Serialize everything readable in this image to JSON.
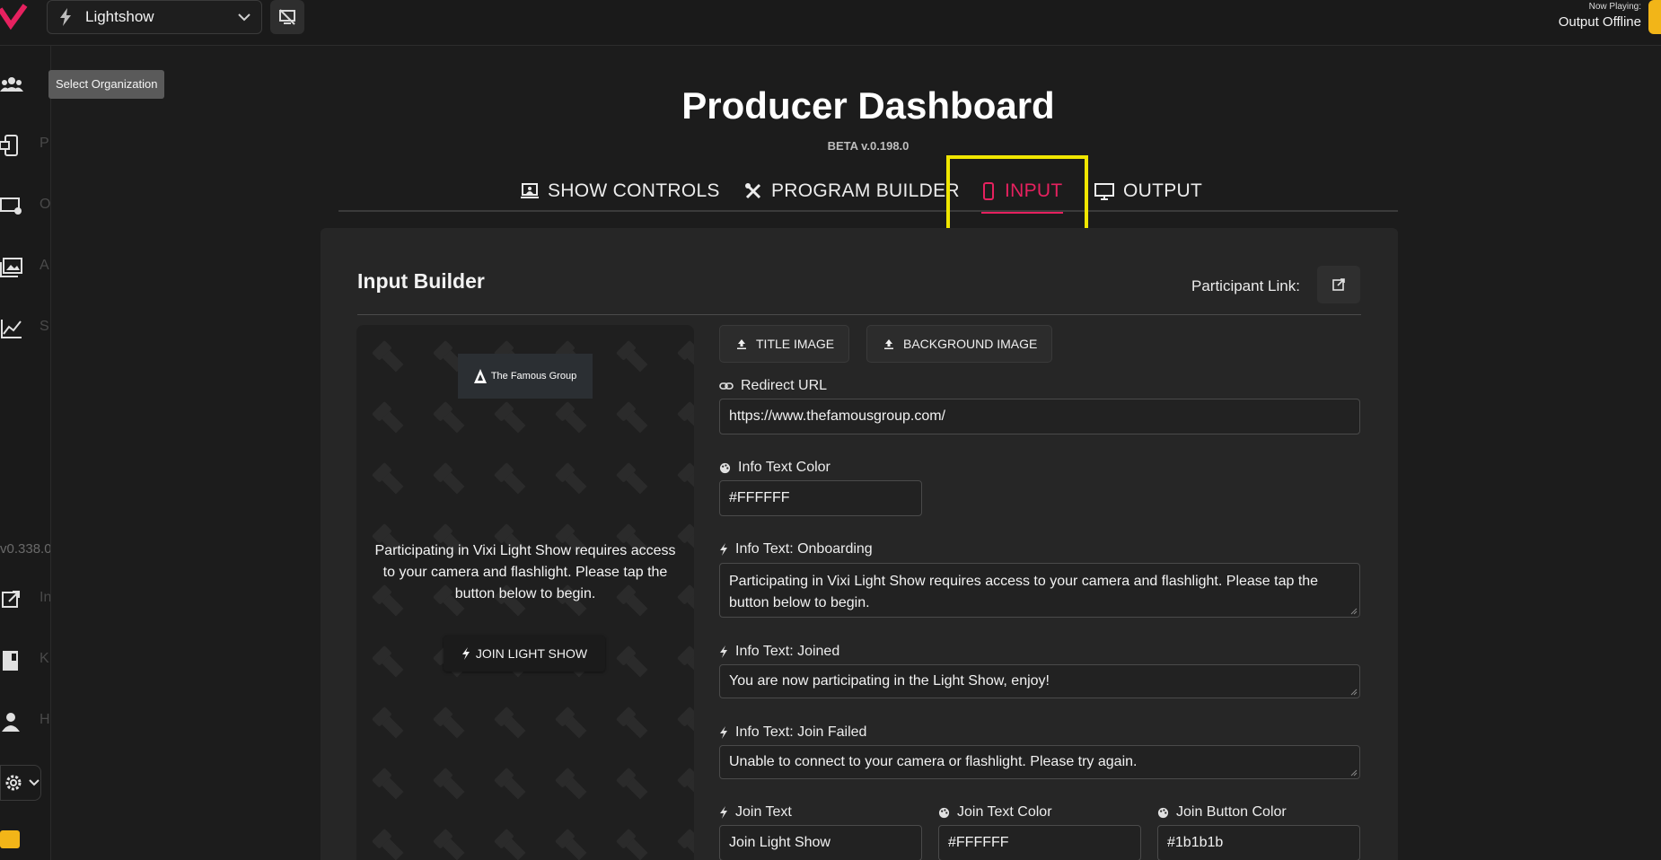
{
  "topbar": {
    "show_name": "Lightshow",
    "now_playing_label": "Now Playing:",
    "now_playing_status": "Output Offline"
  },
  "tooltip": "Select Organization",
  "sidebar": {
    "items": [
      {
        "icon": "organization-icon",
        "label": "O"
      },
      {
        "icon": "device-icon",
        "label": "P"
      },
      {
        "icon": "display-settings-icon",
        "label": "O"
      },
      {
        "icon": "media-library-icon",
        "label": "A"
      },
      {
        "icon": "analytics-icon",
        "label": "S"
      },
      {
        "icon": "external-link-icon",
        "label": "In"
      },
      {
        "icon": "book-icon",
        "label": "K"
      },
      {
        "icon": "user-icon",
        "label": "H"
      }
    ],
    "version": "v0.338.0"
  },
  "header": {
    "title": "Producer Dashboard",
    "beta": "BETA v.0.198.0",
    "tabs": [
      {
        "label": "SHOW CONTROLS",
        "icon": "show-controls-icon"
      },
      {
        "label": "PROGRAM BUILDER",
        "icon": "tools-icon"
      },
      {
        "label": "INPUT",
        "icon": "phone-icon"
      },
      {
        "label": "OUTPUT",
        "icon": "monitor-icon"
      }
    ],
    "active_tab": "INPUT"
  },
  "panel": {
    "title": "Input Builder",
    "participant_link_label": "Participant Link:"
  },
  "preview": {
    "brand": "The Famous Group",
    "info_text": "Participating in Vixi Light Show requires access to your camera and flashlight. Please tap the button below to begin.",
    "join_button": "JOIN LIGHT SHOW"
  },
  "form": {
    "title_image_button": "TITLE IMAGE",
    "background_image_button": "BACKGROUND IMAGE",
    "redirect_url": {
      "label": "Redirect URL",
      "value": "https://www.thefamousgroup.com/"
    },
    "info_text_color": {
      "label": "Info Text Color",
      "value": "#FFFFFF"
    },
    "info_text_onboarding": {
      "label": "Info Text: Onboarding",
      "value": "Participating in Vixi Light Show requires access to your camera and flashlight. Please tap the button below to begin."
    },
    "info_text_joined": {
      "label": "Info Text: Joined",
      "value": "You are now participating in the Light Show, enjoy!"
    },
    "info_text_join_failed": {
      "label": "Info Text: Join Failed",
      "value": "Unable to connect to your camera or flashlight. Please try again."
    },
    "join_text": {
      "label": "Join Text",
      "value": "Join Light Show"
    },
    "join_text_color": {
      "label": "Join Text Color",
      "value": "#FFFFFF"
    },
    "join_button_color": {
      "label": "Join Button Color",
      "value": "#1b1b1b"
    }
  },
  "colors": {
    "accent": "#e6215f",
    "highlight": "#f0e600",
    "warning": "#f2b518",
    "background": "#1c1c1c",
    "panel": "#262626"
  }
}
